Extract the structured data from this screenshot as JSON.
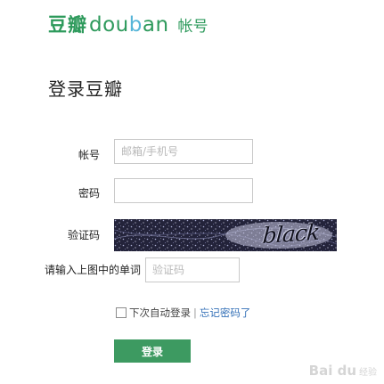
{
  "logo": {
    "chinese": "豆瓣",
    "english_pre": "dou",
    "english_b": "b",
    "english_post": "an",
    "account": "帐号"
  },
  "heading": "登录豆瓣",
  "form": {
    "account_label": "帐号",
    "account_placeholder": "邮箱/手机号",
    "password_label": "密码",
    "captcha_label": "验证码",
    "captcha_word": "black",
    "captcha_prompt": "请输入上图中的单词",
    "captcha_placeholder": "验证码",
    "remember_label": "下次自动登录",
    "separator": "|",
    "forgot_link": "忘记密码了",
    "submit_label": "登录"
  },
  "watermark": {
    "brand": "Bai du",
    "sub": "经验"
  },
  "colors": {
    "brand_green": "#2e9a5c",
    "brand_blue": "#56b5d8",
    "button_green": "#3d9a61",
    "link_blue": "#3672b8"
  }
}
